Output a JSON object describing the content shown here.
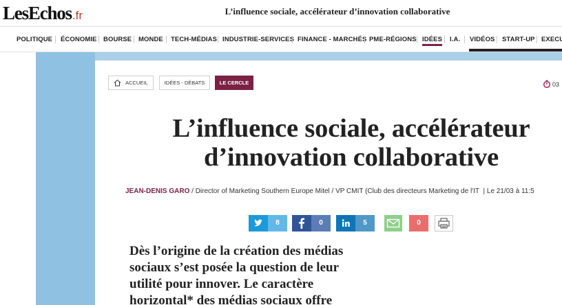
{
  "header": {
    "logo_main": "LesEchos",
    "logo_suffix": ".fr",
    "title": "L’influence sociale, accélérateur d’innovation collaborative"
  },
  "nav": {
    "items": [
      "POLITIQUE",
      "ÉCONOMIE",
      "BOURSE",
      "MONDE",
      "TECH-MÉDIAS",
      "INDUSTRIE-SERVICES",
      "FINANCE - MARCHÉS",
      "PME-RÉGIONS",
      "IDÉES",
      "I.A.",
      "VIDÉOS",
      "START-UP",
      "EXECU"
    ],
    "active": "IDÉES"
  },
  "breadcrumb": {
    "home": "ACCUEIL",
    "section": "IDÉES - DÉBATS",
    "current": "LE CERCLE"
  },
  "timer_text": "03",
  "article": {
    "headline_line1": "L’influence sociale, accélérateur",
    "headline_line2": "d’innovation collaborative",
    "author": "JEAN-DENIS GARO",
    "author_role": " / Director of Marketing Southern Europe Mitel / VP CMIT (Club des directeurs Marketing de l'IT",
    "date": "|  Le 21/03 à 11:5",
    "lead_lines": [
      "Dès l’origine de la création des médias",
      "sociaux s’est posée la question de leur",
      "utilité pour innover. Le caractère",
      "horizontal* des médias sociaux offre"
    ]
  },
  "share": {
    "twitter_count": "8",
    "facebook_count": "0",
    "linkedin_count": "5",
    "pinterest_count": "0"
  },
  "colors": {
    "accent": "#7b2244",
    "twitter": "#1d9ad9",
    "facebook": "#2f5597",
    "linkedin": "#0f75b5",
    "mail": "#8ecf8a",
    "pinterest": "#e86e6e",
    "page_bg": "#a9cfe9"
  }
}
